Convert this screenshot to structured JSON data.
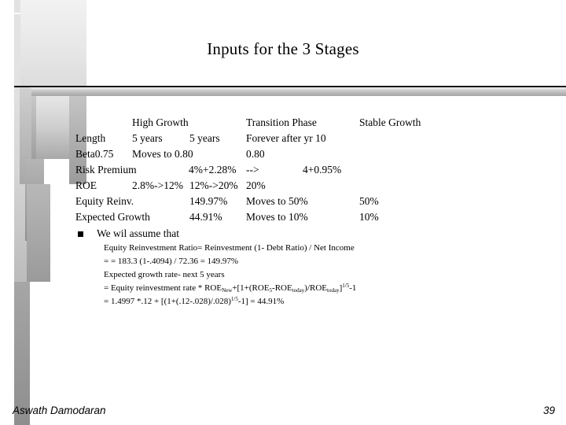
{
  "slide": {
    "title": "Inputs for the 3 Stages",
    "table": {
      "headers": {
        "high_growth": "High Growth",
        "transition": "Transition Phase",
        "stable": "Stable Growth"
      },
      "rows": [
        {
          "label": "Length",
          "c1": "5 years",
          "c2": "5 years",
          "c3": "Forever after yr 10",
          "c4": ""
        },
        {
          "label": "Beta",
          "c1": "0.75",
          "c2": "Moves to 0.80",
          "c3": "0.80",
          "c4": ""
        },
        {
          "label": "Risk Premium",
          "c1": "",
          "c2": "4%+2.28%",
          "c3": "-->",
          "c4": "4+0.95%"
        },
        {
          "label": "ROE",
          "c1": "2.8%->12%",
          "c2": "12%->20%",
          "c3": "20%",
          "c4": ""
        },
        {
          "label": "Equity Reinv.",
          "c1": "",
          "c2": "149.97%",
          "c3": "Moves to 50%",
          "c4": "50%"
        },
        {
          "label": "Expected Growth",
          "c1": "",
          "c2": "44.91%",
          "c3": "Moves to 10%",
          "c4": "10%"
        }
      ]
    },
    "bullet": "We wil assume that",
    "notes": {
      "line1": "Equity Reinvestment Ratio= Reinvestment (1- Debt Ratio) / Net Income",
      "line2": "= = 183.3 (1-.4094) / 72.36 = 149.97%",
      "line3": "Expected growth rate- next 5 years",
      "line4": {
        "a": "= Equity reinvestment rate * ROE",
        "sub_new": "New",
        "b": "+[1+(ROE",
        "sub_5": "5",
        "c": "-ROE",
        "sub_today1": "today",
        "d": ")/ROE",
        "sub_today2": "today",
        "e": "]",
        "sup_exp": "1/5",
        "f": "-1"
      },
      "line5": {
        "a": "= 1.4997 *.12 + [(1+(.12-.028)/.028)",
        "sup_exp": "1/5",
        "b": "-1] = 44.91%"
      }
    },
    "footer": {
      "author": "Aswath Damodaran",
      "page_number": "39"
    }
  }
}
